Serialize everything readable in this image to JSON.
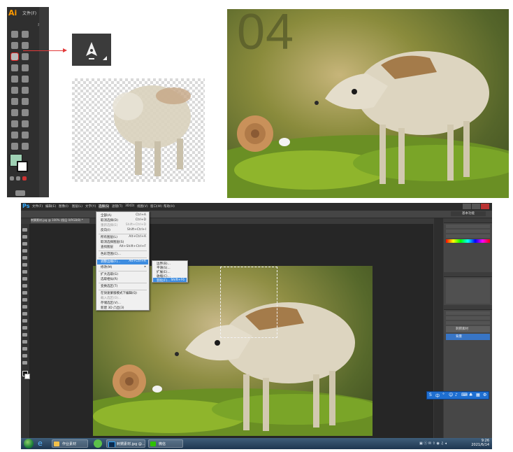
{
  "illustrator": {
    "logo": "Ai",
    "menu_file": "文件(F)",
    "tab_label": "未"
  },
  "photo": {
    "step_number": "04"
  },
  "photoshop": {
    "logo": "Ps",
    "menus": [
      "文件(F)",
      "编辑(E)",
      "图像(I)",
      "图层(L)",
      "文字(Y)",
      "选择(S)",
      "滤镜(T)",
      "3D(D)",
      "视图(V)",
      "窗口(W)",
      "帮助(H)"
    ],
    "workspace": "基本功能",
    "doc_tab": "刺猬素材.jpg @ 100% (图层 0/RGB/8) *",
    "zoom_status": "100%",
    "doc_status": "文档:2.47M/4.72M",
    "select_menu": {
      "items": [
        {
          "label": "全部(A)",
          "shortcut": "Ctrl+A"
        },
        {
          "label": "取消选择(D)",
          "shortcut": "Ctrl+D"
        },
        {
          "label": "重新选择(E)",
          "shortcut": "Shift+Ctrl+D"
        },
        {
          "label": "反向(I)",
          "shortcut": "Shift+Ctrl+I"
        },
        {
          "label": "所有图层(L)",
          "shortcut": "Alt+Ctrl+A"
        },
        {
          "label": "取消选择图层(S)",
          "shortcut": ""
        },
        {
          "label": "查找图层",
          "shortcut": "Alt+Shift+Ctrl+F"
        },
        {
          "label": "色彩范围(C)...",
          "shortcut": ""
        },
        {
          "label": "调整边缘(F)...",
          "shortcut": "Alt+Ctrl+R"
        },
        {
          "label": "修改(M)",
          "shortcut": ""
        },
        {
          "label": "扩大选取(G)",
          "shortcut": ""
        },
        {
          "label": "选取相似(R)",
          "shortcut": ""
        },
        {
          "label": "变换选区(T)",
          "shortcut": ""
        },
        {
          "label": "在快速蒙版模式下编辑(Q)",
          "shortcut": ""
        },
        {
          "label": "载入选区(O)...",
          "shortcut": ""
        },
        {
          "label": "存储选区(V)...",
          "shortcut": ""
        },
        {
          "label": "新建 3D 凸出(3)",
          "shortcut": ""
        }
      ]
    },
    "modify_menu": {
      "items": [
        {
          "label": "边界(B)...",
          "shortcut": ""
        },
        {
          "label": "平滑(S)...",
          "shortcut": ""
        },
        {
          "label": "扩展(E)...",
          "shortcut": ""
        },
        {
          "label": "收缩(C)...",
          "shortcut": ""
        },
        {
          "label": "羽化(F)...",
          "shortcut": "Shift+F6"
        }
      ]
    },
    "layers": [
      {
        "name": "刺猬素材"
      },
      {
        "name": "背景"
      }
    ]
  },
  "ime_bar": {
    "mode": "中"
  },
  "taskbar": {
    "items": [
      {
        "label": "作业素材"
      },
      {
        "label": "刺猬素材.jpg @..."
      },
      {
        "label": "微信"
      }
    ],
    "time": "9:26",
    "date": "2021/6/14"
  },
  "colors": {
    "ai_orange": "#ff9a00",
    "ps_blue": "#31a8ff",
    "highlight": "#3d8ce0",
    "fill_swatch": "#9fd1b4",
    "marker_red": "#e12020"
  }
}
